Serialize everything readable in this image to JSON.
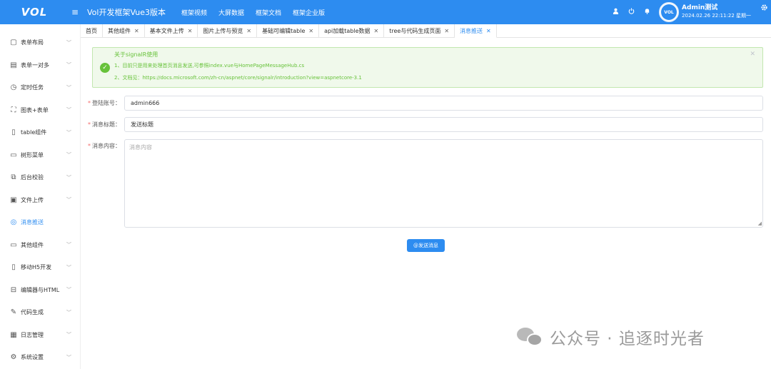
{
  "header": {
    "logo": "VOL",
    "menu_icon": "≡",
    "title": "Vol开发框架Vue3版本",
    "links": [
      "框架视频",
      "大屏数据",
      "框架文档",
      "框架企业版"
    ],
    "user_name": "Admin测试",
    "user_time": "2024.02.26 22:11:22 星期一",
    "avatar_text": "VOL"
  },
  "sidebar": {
    "items": [
      {
        "label": "表单布局",
        "icon": "form-icon"
      },
      {
        "label": "表单一对多",
        "icon": "table-icon"
      },
      {
        "label": "定时任务",
        "icon": "clock-icon"
      },
      {
        "label": "图表+表单",
        "icon": "fullscreen-icon"
      },
      {
        "label": "table组件",
        "icon": "tablet-icon"
      },
      {
        "label": "树形菜单",
        "icon": "card-icon"
      },
      {
        "label": "后台校验",
        "icon": "copy-icon"
      },
      {
        "label": "文件上传",
        "icon": "file-icon"
      },
      {
        "label": "消息推送",
        "icon": "chat-icon",
        "active": true
      },
      {
        "label": "其他组件",
        "icon": "monitor-icon"
      },
      {
        "label": "移动H5开发",
        "icon": "phone-icon"
      },
      {
        "label": "编辑器与HTML",
        "icon": "editor-icon"
      },
      {
        "label": "代码生成",
        "icon": "edit-icon"
      },
      {
        "label": "日志管理",
        "icon": "calendar-icon"
      },
      {
        "label": "系统设置",
        "icon": "gear-icon"
      }
    ]
  },
  "tabs": [
    {
      "label": "首页",
      "closable": false
    },
    {
      "label": "其他组件",
      "closable": true
    },
    {
      "label": "基本文件上传",
      "closable": true
    },
    {
      "label": "图片上传与预览",
      "closable": true
    },
    {
      "label": "基础可编辑table",
      "closable": true
    },
    {
      "label": "api加载table数据",
      "closable": true
    },
    {
      "label": "tree与代码生成页面",
      "closable": true
    },
    {
      "label": "消息推送",
      "closable": true,
      "active": true
    }
  ],
  "alert": {
    "title": "关于signalR使用",
    "line1": "1、目前只是用来处理首页消息发送,可参照index.vue与HomePageMessageHub.cs",
    "line2": "2、文档见：https://docs.microsoft.com/zh-cn/aspnet/core/signalr/introduction?view=aspnetcore-3.1"
  },
  "form": {
    "account_label": "登陆账号：",
    "account_value": "admin666",
    "subject_label": "消息标题：",
    "subject_value": "发送标题",
    "content_label": "消息内容：",
    "content_placeholder": "消息内容",
    "send_label": "@发送消息"
  },
  "watermark": {
    "text": "公众号 · 追逐时光者"
  },
  "colors": {
    "primary": "#2d8cf0",
    "success": "#67c23a",
    "required": "#f56c6c"
  }
}
